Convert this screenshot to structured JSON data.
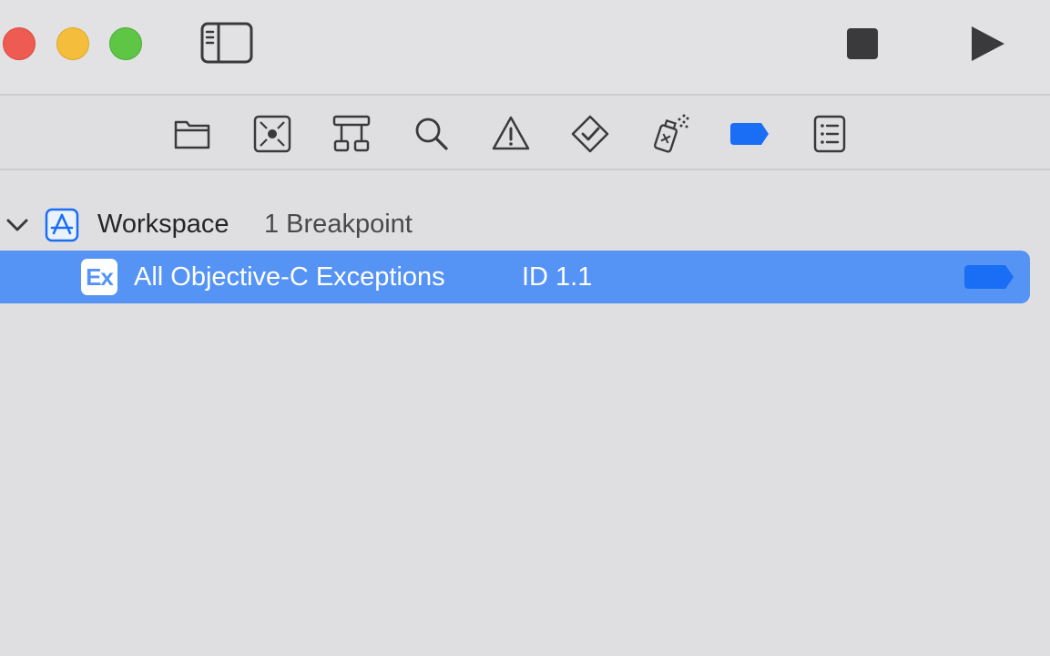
{
  "window": {
    "controls": [
      "close",
      "minimize",
      "zoom"
    ],
    "toolbar_icons": [
      "sidebar-toggle-icon",
      "stop-icon",
      "play-icon"
    ]
  },
  "navigator": {
    "tabs": [
      {
        "icon": "folder-icon"
      },
      {
        "icon": "source-control-icon"
      },
      {
        "icon": "hierarchy-icon"
      },
      {
        "icon": "search-icon"
      },
      {
        "icon": "warning-icon"
      },
      {
        "icon": "test-diamond-icon"
      },
      {
        "icon": "debug-spray-icon"
      },
      {
        "icon": "breakpoint-icon",
        "selected": true
      },
      {
        "icon": "report-list-icon"
      }
    ]
  },
  "breakpoints": {
    "group": {
      "title": "Workspace",
      "count": "1 Breakpoint"
    },
    "items": [
      {
        "badge": "Ex",
        "name": "All Objective-C Exceptions",
        "id": "ID 1.1",
        "enabled": true
      }
    ]
  },
  "colors": {
    "accent": "#1a6ef5",
    "selection": "#5593f5",
    "close": "#ee5b52",
    "minimize": "#f5bd3c",
    "zoom": "#5ec545"
  }
}
